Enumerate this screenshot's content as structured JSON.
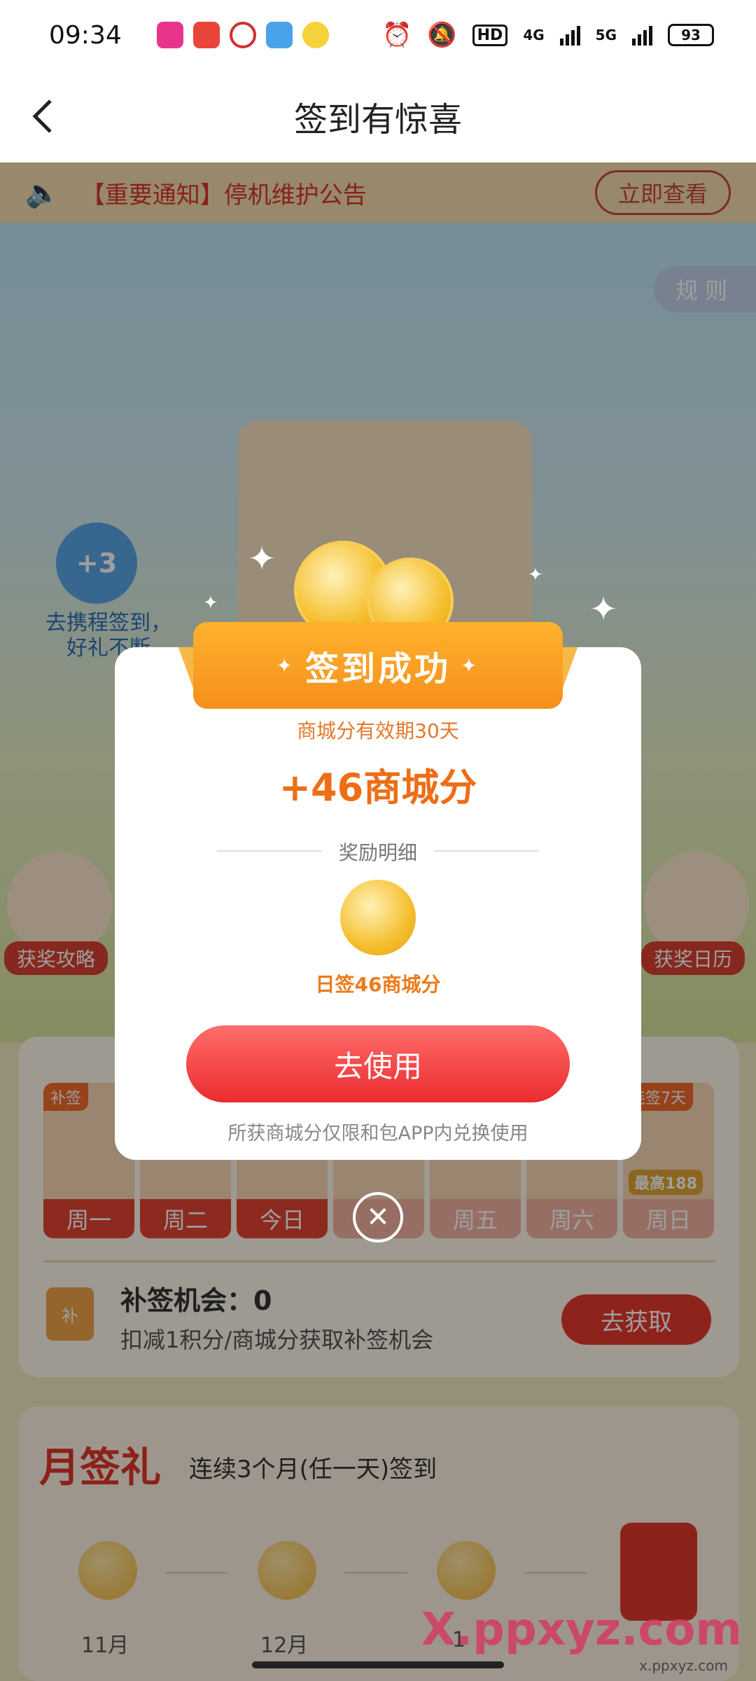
{
  "status_bar": {
    "time": "09:34",
    "hd_label": "HD",
    "net_4g": "4G",
    "net_5g": "5G",
    "battery": "93"
  },
  "nav": {
    "back_icon": "chevron-left",
    "title": "签到有惊喜"
  },
  "notice": {
    "text": "【重要通知】停机维护公告",
    "button": "立即查看"
  },
  "page": {
    "rules_tab": "规则",
    "bonus_badge": "+3",
    "bonus_text_line1": "去携程签到，",
    "bonus_text_line2": "好礼不断",
    "left_button": "获奖攻略",
    "right_button": "获奖日历"
  },
  "week": {
    "days": [
      {
        "label": "周一",
        "tag": "补签"
      },
      {
        "label": "周二"
      },
      {
        "label": "今日"
      },
      {
        "label": ""
      },
      {
        "label": "周五"
      },
      {
        "label": "周六"
      },
      {
        "label": "周日",
        "tag": "连签7天",
        "max": "最高188"
      }
    ],
    "resign": {
      "icon_label": "补",
      "title": "补签机会：0",
      "subtitle": "扣减1积分/商城分获取补签机会",
      "button": "去获取"
    }
  },
  "month": {
    "title": "月签礼",
    "subtitle": "连续3个月(任一天)签到",
    "months": [
      "11月",
      "12月",
      "1"
    ]
  },
  "modal": {
    "banner": "签到成功",
    "validity": "商城分有效期30天",
    "amount": "+46商城分",
    "detail_header": "奖励明细",
    "coin_label": "日签46商城分",
    "use_button": "去使用",
    "footnote": "所获商城分仅限和包APP内兑换使用",
    "close_icon": "close"
  },
  "watermark": {
    "text": "X.ppxyz.com",
    "sub": "x.ppxyz.com"
  },
  "colors": {
    "accent_red": "#e6392c",
    "accent_orange": "#f5901b",
    "amount_orange": "#ec6e16"
  }
}
